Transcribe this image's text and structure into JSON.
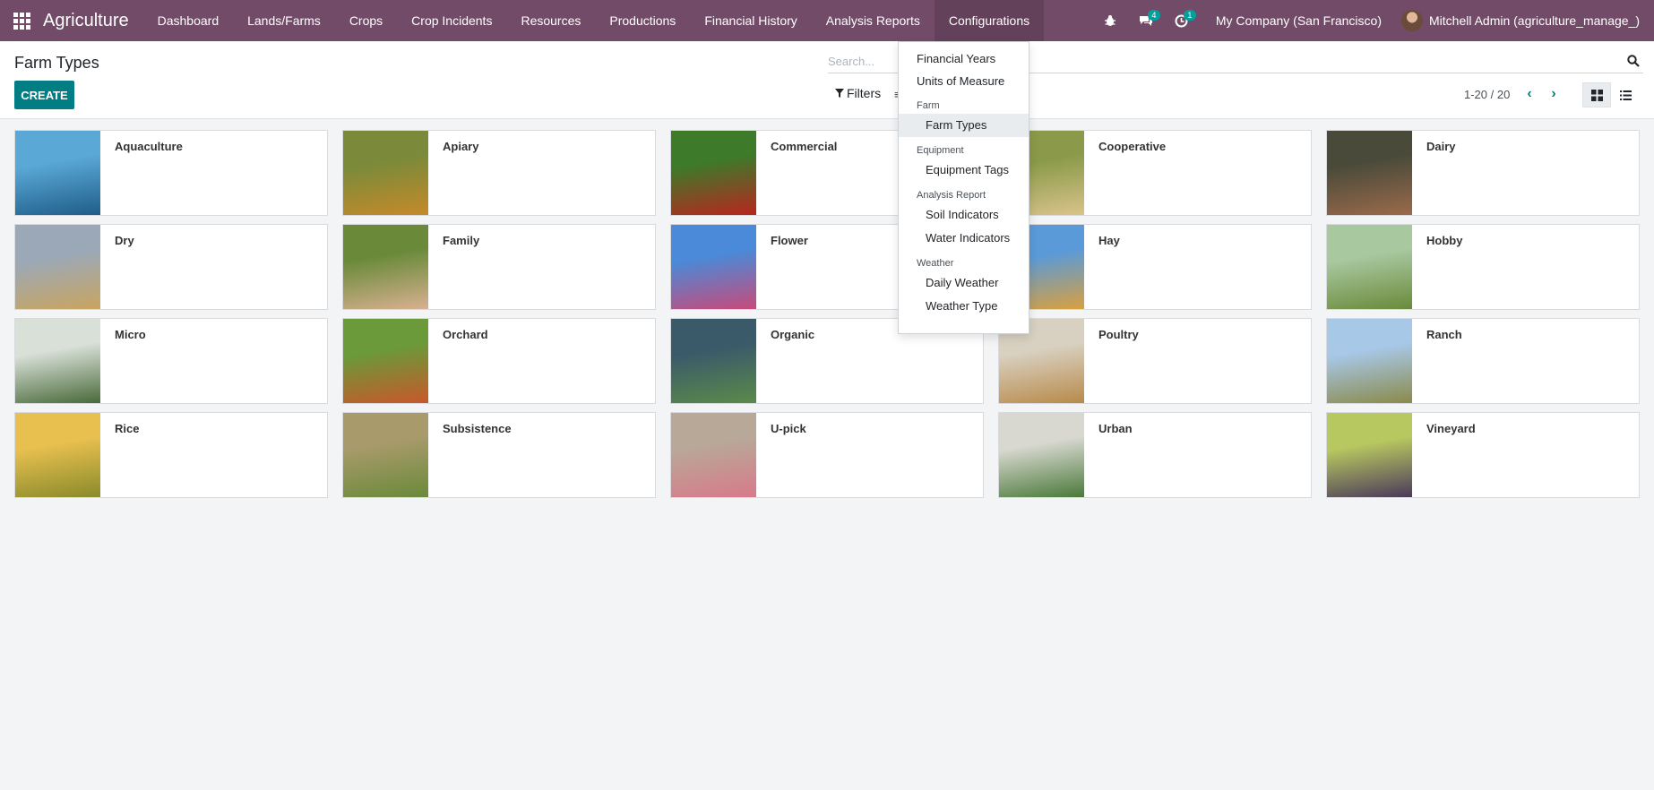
{
  "app": {
    "brand": "Agriculture"
  },
  "nav": {
    "items": [
      {
        "label": "Dashboard"
      },
      {
        "label": "Lands/Farms"
      },
      {
        "label": "Crops"
      },
      {
        "label": "Crop Incidents"
      },
      {
        "label": "Resources"
      },
      {
        "label": "Productions"
      },
      {
        "label": "Financial History"
      },
      {
        "label": "Analysis Reports"
      },
      {
        "label": "Configurations"
      }
    ],
    "messages_count": "4",
    "activities_count": "1",
    "company": "My Company (San Francisco)",
    "user": "Mitchell Admin (agriculture_manage_)"
  },
  "control": {
    "title": "Farm Types",
    "create_label": "CREATE",
    "search_placeholder": "Search...",
    "filters_label": "Filters",
    "pager": "1-20 / 20"
  },
  "dropdown": {
    "top_items": [
      "Financial Years",
      "Units of Measure"
    ],
    "sections": [
      {
        "header": "Farm",
        "items": [
          "Farm Types"
        ]
      },
      {
        "header": "Equipment",
        "items": [
          "Equipment Tags"
        ]
      },
      {
        "header": "Analysis Report",
        "items": [
          "Soil Indicators",
          "Water Indicators"
        ]
      },
      {
        "header": "Weather",
        "items": [
          "Daily Weather",
          "Weather Type"
        ]
      }
    ],
    "selected": "Farm Types"
  },
  "cards": [
    {
      "name": "Aquaculture",
      "colors": [
        "#5aa8d6",
        "#1f5d8a"
      ]
    },
    {
      "name": "Apiary",
      "colors": [
        "#7a8a3a",
        "#c58a2a"
      ]
    },
    {
      "name": "Commercial",
      "colors": [
        "#3d7a2a",
        "#b8261e"
      ]
    },
    {
      "name": "Cooperative",
      "colors": [
        "#8a9a4a",
        "#d9c38a"
      ]
    },
    {
      "name": "Dairy",
      "colors": [
        "#4a4a3a",
        "#9a6a4a"
      ]
    },
    {
      "name": "Dry",
      "colors": [
        "#9aa8b8",
        "#c9a560"
      ]
    },
    {
      "name": "Family",
      "colors": [
        "#6a8a3a",
        "#d8b090"
      ]
    },
    {
      "name": "Flower",
      "colors": [
        "#4a8ad8",
        "#c84a7a"
      ]
    },
    {
      "name": "Hay",
      "colors": [
        "#5a9ad8",
        "#d8a040"
      ]
    },
    {
      "name": "Hobby",
      "colors": [
        "#a8c8a0",
        "#6a8a3a"
      ]
    },
    {
      "name": "Micro",
      "colors": [
        "#d8e0d8",
        "#4a6a3a"
      ]
    },
    {
      "name": "Orchard",
      "colors": [
        "#6a9a3a",
        "#c8582a"
      ]
    },
    {
      "name": "Organic",
      "colors": [
        "#3a5a6a",
        "#5a8a4a"
      ]
    },
    {
      "name": "Poultry",
      "colors": [
        "#d8d0c0",
        "#b88a4a"
      ]
    },
    {
      "name": "Ranch",
      "colors": [
        "#a8c8e8",
        "#8a8a4a"
      ]
    },
    {
      "name": "Rice",
      "colors": [
        "#e8c050",
        "#8a8a2a"
      ]
    },
    {
      "name": "Subsistence",
      "colors": [
        "#a89a6a",
        "#6a8a3a"
      ]
    },
    {
      "name": "U-pick",
      "colors": [
        "#b8a898",
        "#d87a8a"
      ]
    },
    {
      "name": "Urban",
      "colors": [
        "#d8d8d0",
        "#4a7a3a"
      ]
    },
    {
      "name": "Vineyard",
      "colors": [
        "#b8c860",
        "#4a3a5a"
      ]
    }
  ]
}
